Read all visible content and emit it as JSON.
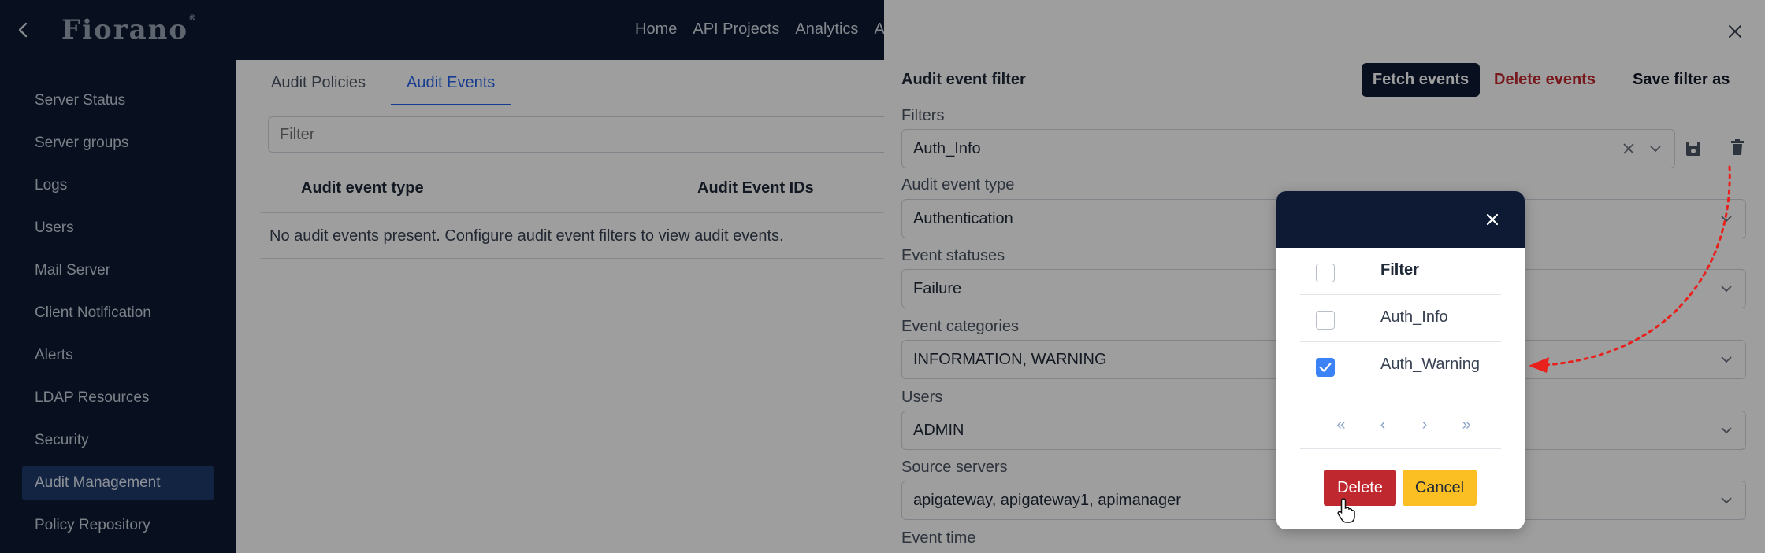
{
  "header": {
    "brand": "Fiorano",
    "nav": [
      "Home",
      "API Projects",
      "Analytics",
      "Ap"
    ]
  },
  "sidebar": {
    "items": [
      {
        "label": "Server Status"
      },
      {
        "label": "Server groups"
      },
      {
        "label": "Logs"
      },
      {
        "label": "Users"
      },
      {
        "label": "Mail Server"
      },
      {
        "label": "Client Notification"
      },
      {
        "label": "Alerts"
      },
      {
        "label": "LDAP Resources"
      },
      {
        "label": "Security"
      },
      {
        "label": "Audit Management"
      },
      {
        "label": "Policy Repository"
      }
    ],
    "active": "Audit Management"
  },
  "main": {
    "tabs": [
      "Audit Policies",
      "Audit Events"
    ],
    "active_tab": "Audit Events",
    "filter_placeholder": "Filter",
    "columns": [
      "Audit event type",
      "Audit Event IDs"
    ],
    "empty_message": "No audit events present. Configure audit event filters to view audit events."
  },
  "drawer": {
    "title": "Audit event filter",
    "fetch_label": "Fetch events",
    "delete_events_label": "Delete events",
    "save_filter_label": "Save filter as",
    "fields": [
      {
        "label": "Filters",
        "value": "Auth_Info"
      },
      {
        "label": "Audit event type",
        "value": "Authentication"
      },
      {
        "label": "Event statuses",
        "value": "Failure"
      },
      {
        "label": "Event categories",
        "value": "INFORMATION, WARNING"
      },
      {
        "label": "Users",
        "value": "ADMIN"
      },
      {
        "label": "Source servers",
        "value": "apigateway, apigateway1, apimanager"
      },
      {
        "label": "Event time",
        "value": ""
      }
    ]
  },
  "modal": {
    "header_label": "Filter",
    "rows": [
      {
        "label": "Auth_Info",
        "checked": false
      },
      {
        "label": "Auth_Warning",
        "checked": true
      }
    ],
    "pager": [
      "«",
      "‹",
      "›",
      "»"
    ],
    "delete_label": "Delete",
    "cancel_label": "Cancel"
  },
  "colors": {
    "nav_bg": "#0e1a33",
    "accent": "#2563eb",
    "danger": "#c0282f",
    "warning": "#fbbf24",
    "annotation": "#e8211c"
  }
}
